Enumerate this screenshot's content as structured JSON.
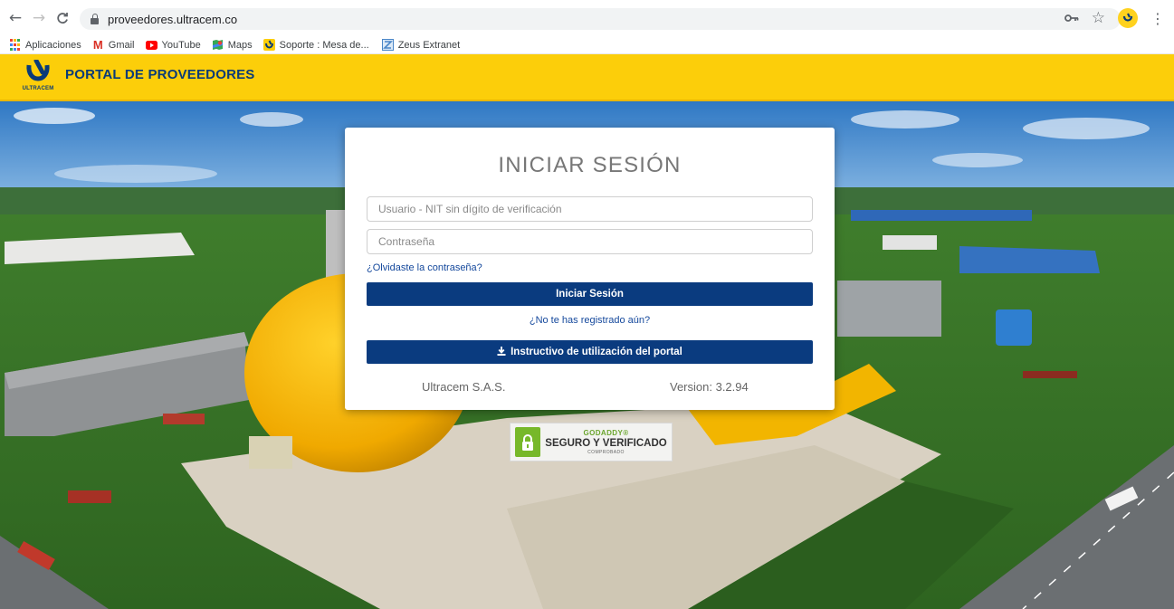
{
  "browser": {
    "url": "proveedores.ultracem.co",
    "back_glyph": "←",
    "forward_glyph": "→",
    "reload_glyph": "C",
    "key_glyph": "⚿",
    "star_glyph": "☆",
    "menu_glyph": "⋮",
    "icons": [
      "back-icon",
      "forward-icon",
      "reload-icon",
      "lock-icon",
      "key-icon",
      "star-icon",
      "profile-avatar",
      "menu-icon"
    ]
  },
  "bookmarks": [
    {
      "label": "Aplicaciones",
      "icon": "apps-icon"
    },
    {
      "label": "Gmail",
      "icon": "gmail-icon",
      "glyph": "M",
      "color": "#d93025"
    },
    {
      "label": "YouTube",
      "icon": "youtube-icon",
      "color": "#ff0000"
    },
    {
      "label": "Maps",
      "icon": "maps-icon",
      "color": "#34a853"
    },
    {
      "label": "Soporte : Mesa de...",
      "icon": "ultracem-icon",
      "color": "#fcce0a"
    },
    {
      "label": "Zeus Extranet",
      "icon": "zeus-icon",
      "color": "#4a86c8"
    }
  ],
  "header": {
    "logo_text": "ULTRACEM",
    "title": "PORTAL DE PROVEEDORES",
    "background": "#fcce0a",
    "brand_blue": "#0a3b78"
  },
  "login": {
    "title": "INICIAR SESIÓN",
    "username_placeholder": "Usuario - NIT sin dígito de verificación",
    "password_placeholder": "Contraseña",
    "forgot_link": "¿Olvidaste la contraseña?",
    "login_button": "Iniciar Sesión",
    "register_link": "¿No te has registrado aún?",
    "manual_button": "Instructivo de utilización del portal",
    "manual_icon": "download-icon",
    "company": "Ultracem S.A.S.",
    "version": "Version: 3.2.94",
    "button_color": "#0a3b7f",
    "link_color": "#14489c"
  },
  "badge": {
    "brand": "GODADDY®",
    "main": "SEGURO Y VERIFICADO",
    "sub": "COMPROBADO",
    "lock_color": "#77b82a"
  }
}
